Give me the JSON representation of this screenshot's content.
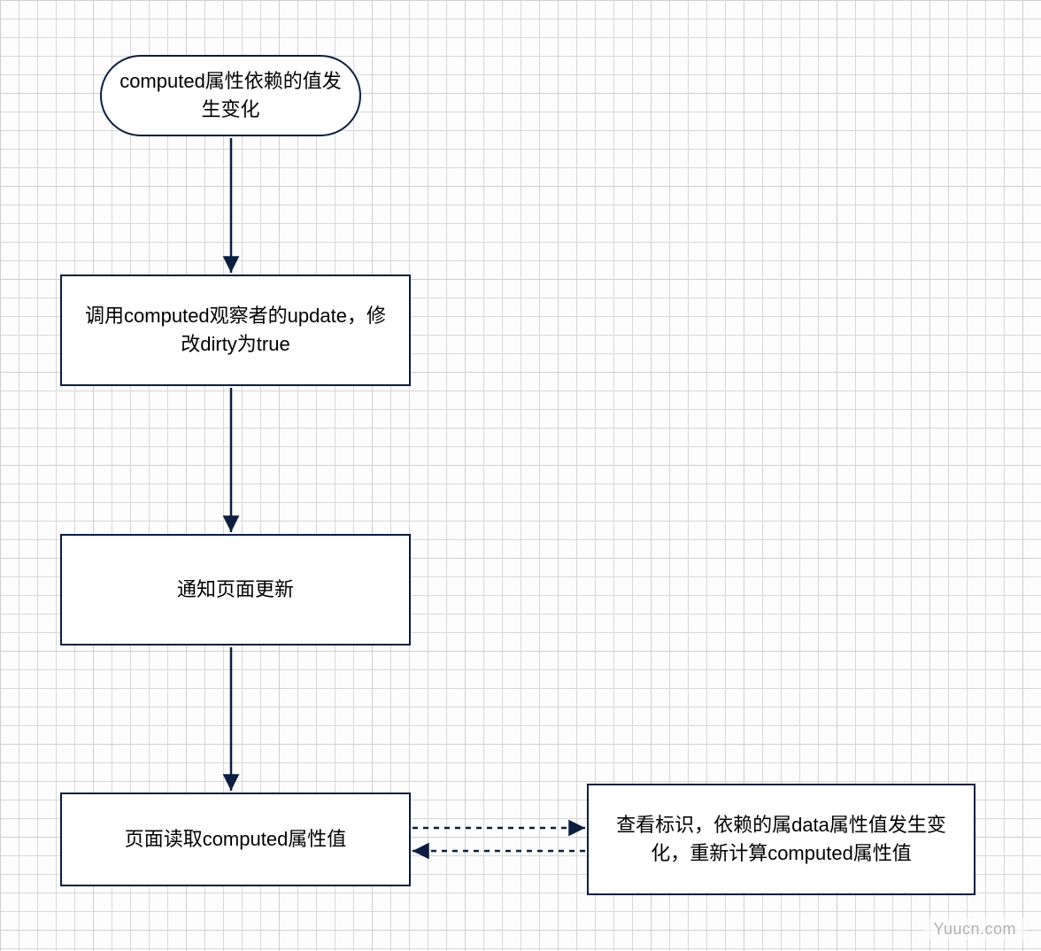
{
  "nodes": {
    "start": {
      "text": "computed属性依赖的值发生变化"
    },
    "update": {
      "text": "调用computed观察者的update，修改dirty为true"
    },
    "notify": {
      "text": "通知页面更新"
    },
    "read": {
      "text": "页面读取computed属性值"
    },
    "recalc": {
      "text": "查看标识，依赖的属data属性值发生变化，重新计算computed属性值"
    }
  },
  "watermark": "Yuucn.com"
}
